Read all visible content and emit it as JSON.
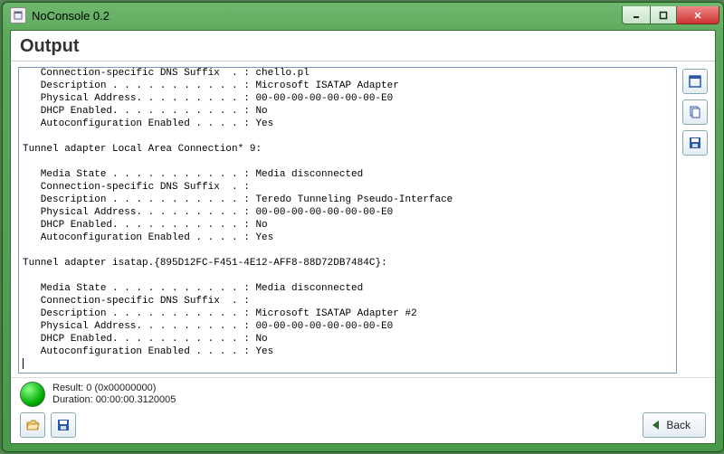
{
  "window": {
    "title": "NoConsole 0.2"
  },
  "heading": "Output",
  "output_text": "   Connection-specific DNS Suffix  . : chello.pl\n   Description . . . . . . . . . . . : Microsoft ISATAP Adapter\n   Physical Address. . . . . . . . . : 00-00-00-00-00-00-00-E0\n   DHCP Enabled. . . . . . . . . . . : No\n   Autoconfiguration Enabled . . . . : Yes\n\nTunnel adapter Local Area Connection* 9:\n\n   Media State . . . . . . . . . . . : Media disconnected\n   Connection-specific DNS Suffix  . :\n   Description . . . . . . . . . . . : Teredo Tunneling Pseudo-Interface\n   Physical Address. . . . . . . . . : 00-00-00-00-00-00-00-E0\n   DHCP Enabled. . . . . . . . . . . : No\n   Autoconfiguration Enabled . . . . : Yes\n\nTunnel adapter isatap.{895D12FC-F451-4E12-AFF8-88D72DB7484C}:\n\n   Media State . . . . . . . . . . . : Media disconnected\n   Connection-specific DNS Suffix  . :\n   Description . . . . . . . . . . . : Microsoft ISATAP Adapter #2\n   Physical Address. . . . . . . . . : 00-00-00-00-00-00-00-E0\n   DHCP Enabled. . . . . . . . . . . : No\n   Autoconfiguration Enabled . . . . : Yes\n",
  "status": {
    "result_line": "Result: 0 (0x00000000)",
    "duration_line": "Duration: 00:00:00.3120005",
    "color": "#1aaa1a"
  },
  "buttons": {
    "back_label": "Back"
  },
  "side_tools": {
    "icon1": "maximize-output-icon",
    "icon2": "copy-icon",
    "icon3": "save-icon"
  },
  "bottom_tools": {
    "icon1": "open-folder-icon",
    "icon2": "save-disk-icon"
  }
}
